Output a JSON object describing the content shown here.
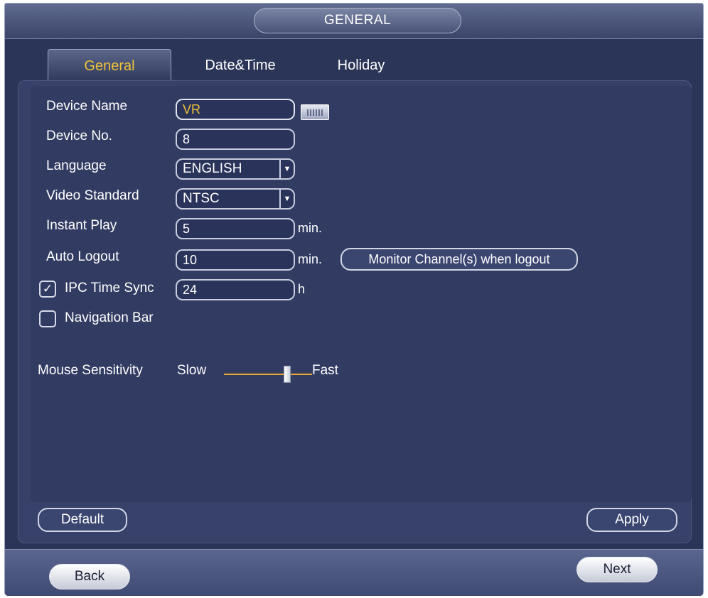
{
  "window": {
    "title": "GENERAL"
  },
  "tabs": [
    {
      "label": "General",
      "active": true
    },
    {
      "label": "Date&Time",
      "active": false
    },
    {
      "label": "Holiday",
      "active": false
    }
  ],
  "form": {
    "device_name": {
      "label": "Device Name",
      "value": "VR"
    },
    "device_no": {
      "label": "Device No.",
      "value": "8"
    },
    "language": {
      "label": "Language",
      "value": "ENGLISH"
    },
    "video_standard": {
      "label": "Video Standard",
      "value": "NTSC"
    },
    "instant_play": {
      "label": "Instant Play",
      "value": "5",
      "unit": "min."
    },
    "auto_logout": {
      "label": "Auto Logout",
      "value": "10",
      "unit": "min.",
      "button": "Monitor Channel(s) when logout"
    },
    "ipc_time_sync": {
      "label": "IPC Time Sync",
      "checked": true,
      "value": "24",
      "unit": "h"
    },
    "navigation_bar": {
      "label": "Navigation Bar",
      "checked": false
    },
    "mouse_sensitivity": {
      "label": "Mouse Sensitivity",
      "slow": "Slow",
      "fast": "Fast",
      "level": 0.7
    }
  },
  "icons": {
    "keyboard": "keyboard-icon",
    "dropdown": "chevron-down-icon",
    "check": "checkmark-icon"
  },
  "actions": {
    "default": "Default",
    "apply": "Apply",
    "back": "Back",
    "next": "Next"
  },
  "colors": {
    "accent": "#f0c23a",
    "background": "#2b3558",
    "slider": "#e8a534"
  }
}
